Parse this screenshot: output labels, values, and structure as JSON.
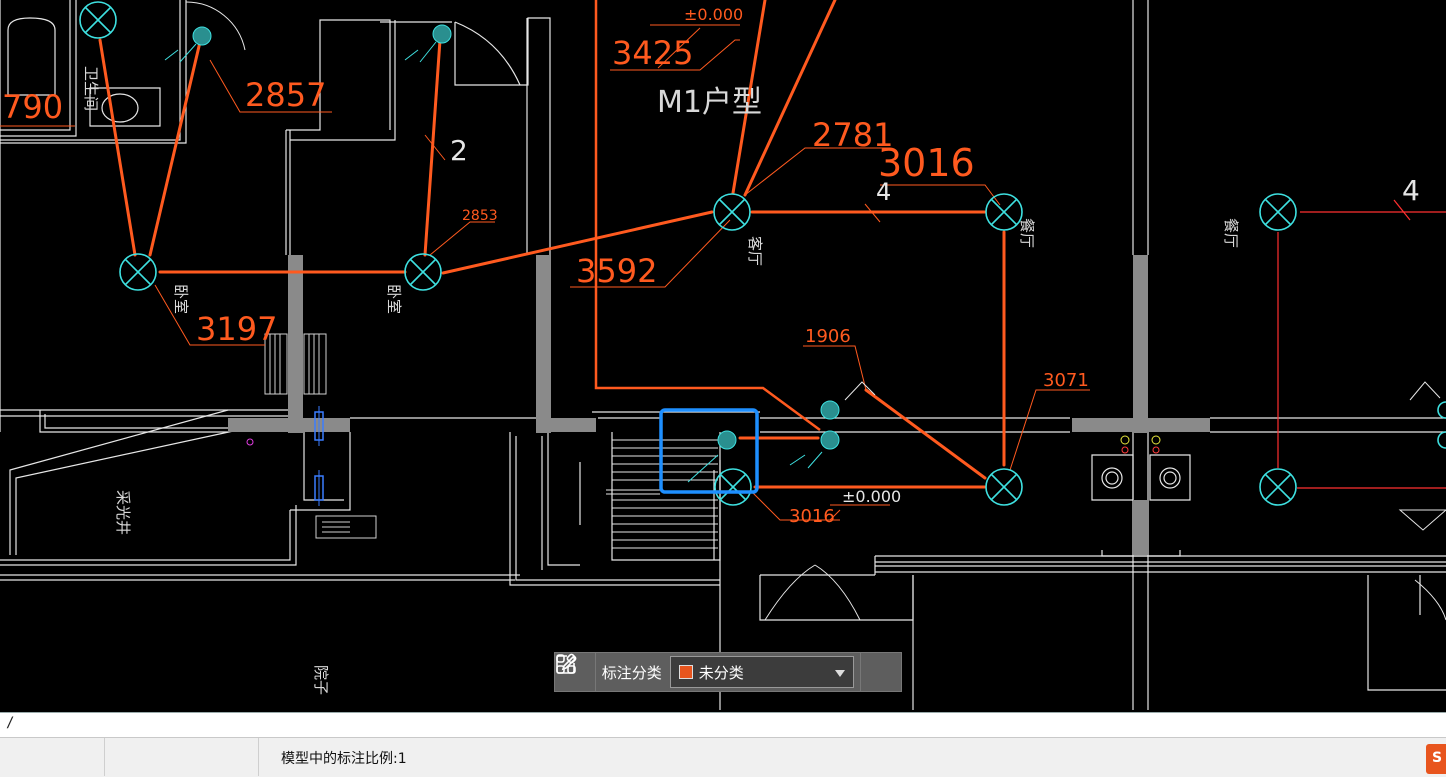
{
  "drawing": {
    "dimension_labels": [
      "±0.000",
      "3425",
      "M1户型",
      "2857",
      "790",
      "2",
      "2781",
      "3016",
      "4",
      "4",
      "2853",
      "3592",
      "3197",
      "1906",
      "3071",
      "3016",
      "±0.000"
    ],
    "room_labels": [
      "卫生间",
      "卧室",
      "卧室",
      "客厅",
      "餐厅",
      "餐厅",
      "采光井",
      "院子"
    ],
    "accent_color": "#ff5a1f",
    "fixture_color": "#3ee0e0",
    "selection_color": "#1e8fff"
  },
  "toolbar": {
    "grid_icon": "grid-icon",
    "label": "标注分类",
    "selected_value": "未分类",
    "swatch_color": "#e8551e",
    "edit_icon": "edit-icon"
  },
  "command_line": {
    "value": ""
  },
  "status_bar": {
    "text": "模型中的标注比例:1"
  }
}
